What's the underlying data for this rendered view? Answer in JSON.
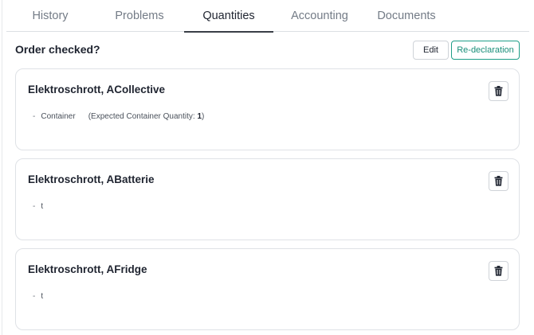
{
  "tabs": [
    {
      "label": "History"
    },
    {
      "label": "Problems"
    },
    {
      "label": "Quantities",
      "active": true
    },
    {
      "label": "Accounting"
    },
    {
      "label": "Documents"
    }
  ],
  "order": {
    "checked_label": "Order checked?",
    "edit_label": "Edit",
    "redeclaration_label": "Re-declaration"
  },
  "cards": [
    {
      "title": "Elektroschrott, ACollective",
      "item": "Container",
      "expected_prefix": "(Expected Container Quantity: ",
      "expected_value": "1",
      "expected_suffix": ")"
    },
    {
      "title": "Elektroschrott, ABatterie",
      "item": "t"
    },
    {
      "title": "Elektroschrott, AFridge",
      "item": "t"
    }
  ],
  "icons": {
    "delete": "trash-icon"
  }
}
